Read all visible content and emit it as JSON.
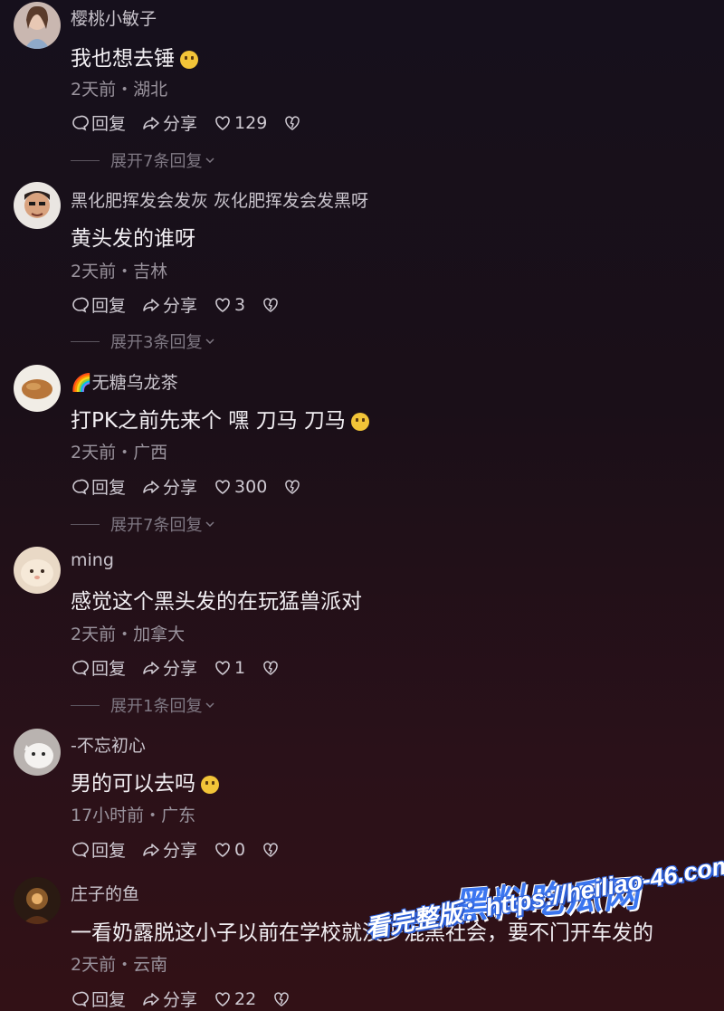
{
  "comments": [
    {
      "username": "樱桃小敏子",
      "content": "我也想去锤",
      "time_location": "2天前・湖北",
      "reply_label": "回复",
      "share_label": "分享",
      "likes": "129",
      "expand_text": "展开7条回复",
      "has_emoji": true
    },
    {
      "username": "黑化肥挥发会发灰 灰化肥挥发会发黑呀",
      "content": "黄头发的谁呀",
      "time_location": "2天前・吉林",
      "reply_label": "回复",
      "share_label": "分享",
      "likes": "3",
      "expand_text": "展开3条回复",
      "has_emoji": false
    },
    {
      "username": "🌈无糖乌龙茶",
      "content": "打PK之前先来个 嘿 刀马 刀马",
      "time_location": "2天前・广西",
      "reply_label": "回复",
      "share_label": "分享",
      "likes": "300",
      "expand_text": "展开7条回复",
      "has_emoji": true
    },
    {
      "username": "ming",
      "content": "感觉这个黑头发的在玩猛兽派对",
      "time_location": "2天前・加拿大",
      "reply_label": "回复",
      "share_label": "分享",
      "likes": "1",
      "expand_text": "展开1条回复",
      "has_emoji": false
    },
    {
      "username": "-不忘初心",
      "content": "男的可以去吗",
      "time_location": "17小时前・广东",
      "reply_label": "回复",
      "share_label": "分享",
      "likes": "0",
      "expand_text": "",
      "has_emoji": true
    },
    {
      "username": "庄子的鱼",
      "content": "一看奶露脱这小子以前在学校就没少混黑社会，要不门开车发的",
      "time_location": "2天前・云南",
      "reply_label": "回复",
      "share_label": "分享",
      "likes": "22",
      "expand_text": "",
      "has_emoji": false
    }
  ],
  "watermark": {
    "title": "黑料吃瓜网",
    "url_text": "看完整版：https://heiliao-46.com"
  },
  "colors": {
    "background": "#1a0f18",
    "text": "#f2eff3",
    "meta": "#9a939d",
    "watermark_blue": "#3b76f0"
  }
}
